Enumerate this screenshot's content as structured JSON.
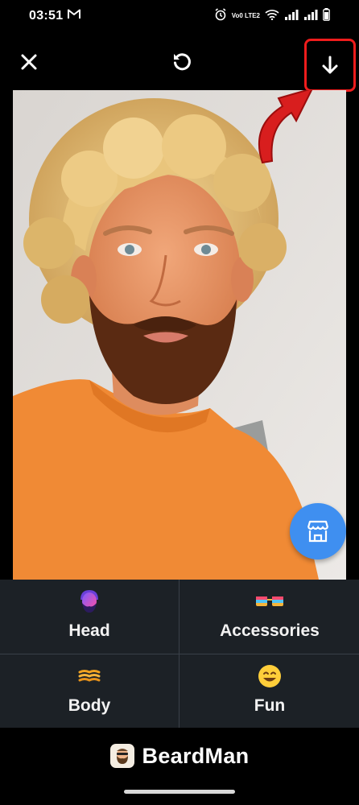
{
  "status_bar": {
    "time": "03:51",
    "notification_icon": "gmail-icon",
    "volte_label": "Vo0 LTE2",
    "icons": [
      "alarm-icon",
      "volte-icon",
      "wifi-icon",
      "signal-icon",
      "signal-icon",
      "battery-icon"
    ]
  },
  "toolbar": {
    "close_icon": "close-icon",
    "undo_icon": "undo-icon",
    "download_icon": "download-arrow-icon",
    "highlight_color": "#ef1c1c"
  },
  "canvas": {
    "description_icon": "photo-with-beard",
    "store_button_icon": "store-icon",
    "store_button_color": "#3f8ff0"
  },
  "categories": [
    {
      "label": "Head",
      "icon": "head-icon"
    },
    {
      "label": "Accessories",
      "icon": "glasses-icon"
    },
    {
      "label": "Body",
      "icon": "mustache-icon"
    },
    {
      "label": "Fun",
      "icon": "smile-emoji-icon"
    }
  ],
  "brand": {
    "name": "BeardMan",
    "logo_icon": "beardman-logo-icon"
  },
  "colors": {
    "background": "#000000",
    "panel": "#1c2126",
    "accent": "#3f8ff0"
  }
}
